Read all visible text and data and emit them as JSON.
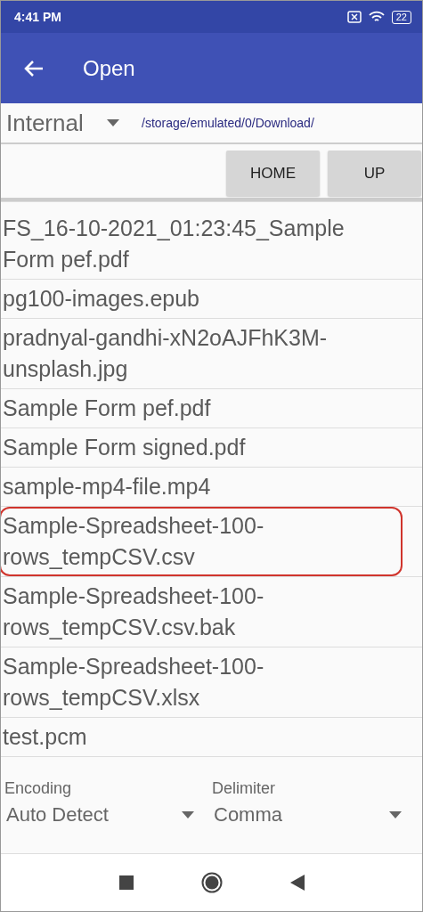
{
  "status_bar": {
    "time": "4:41 PM",
    "battery": "22"
  },
  "app_bar": {
    "title": "Open"
  },
  "location": {
    "storage": "Internal",
    "path": "/storage/emulated/0/Download/"
  },
  "buttons": [
    "HOME",
    "UP"
  ],
  "files": [
    {
      "name": "FS_16-10-2021_01:23:45_Sample Form pef.pdf",
      "highlighted": false
    },
    {
      "name": "pg100-images.epub",
      "highlighted": false
    },
    {
      "name": "pradnyal-gandhi-xN2oAJFhK3M-unsplash.jpg",
      "highlighted": false
    },
    {
      "name": "Sample Form pef.pdf",
      "highlighted": false
    },
    {
      "name": "Sample Form signed.pdf",
      "highlighted": false
    },
    {
      "name": "sample-mp4-file.mp4",
      "highlighted": false
    },
    {
      "name": "Sample-Spreadsheet-100-rows_tempCSV.csv",
      "highlighted": true
    },
    {
      "name": "Sample-Spreadsheet-100-rows_tempCSV.csv.bak",
      "highlighted": false
    },
    {
      "name": "Sample-Spreadsheet-100-rows_tempCSV.xlsx",
      "highlighted": false
    },
    {
      "name": "test.pcm",
      "highlighted": false
    }
  ],
  "options": [
    {
      "label": "Encoding",
      "value": "Auto Detect"
    },
    {
      "label": "Delimiter",
      "value": "Comma"
    }
  ]
}
